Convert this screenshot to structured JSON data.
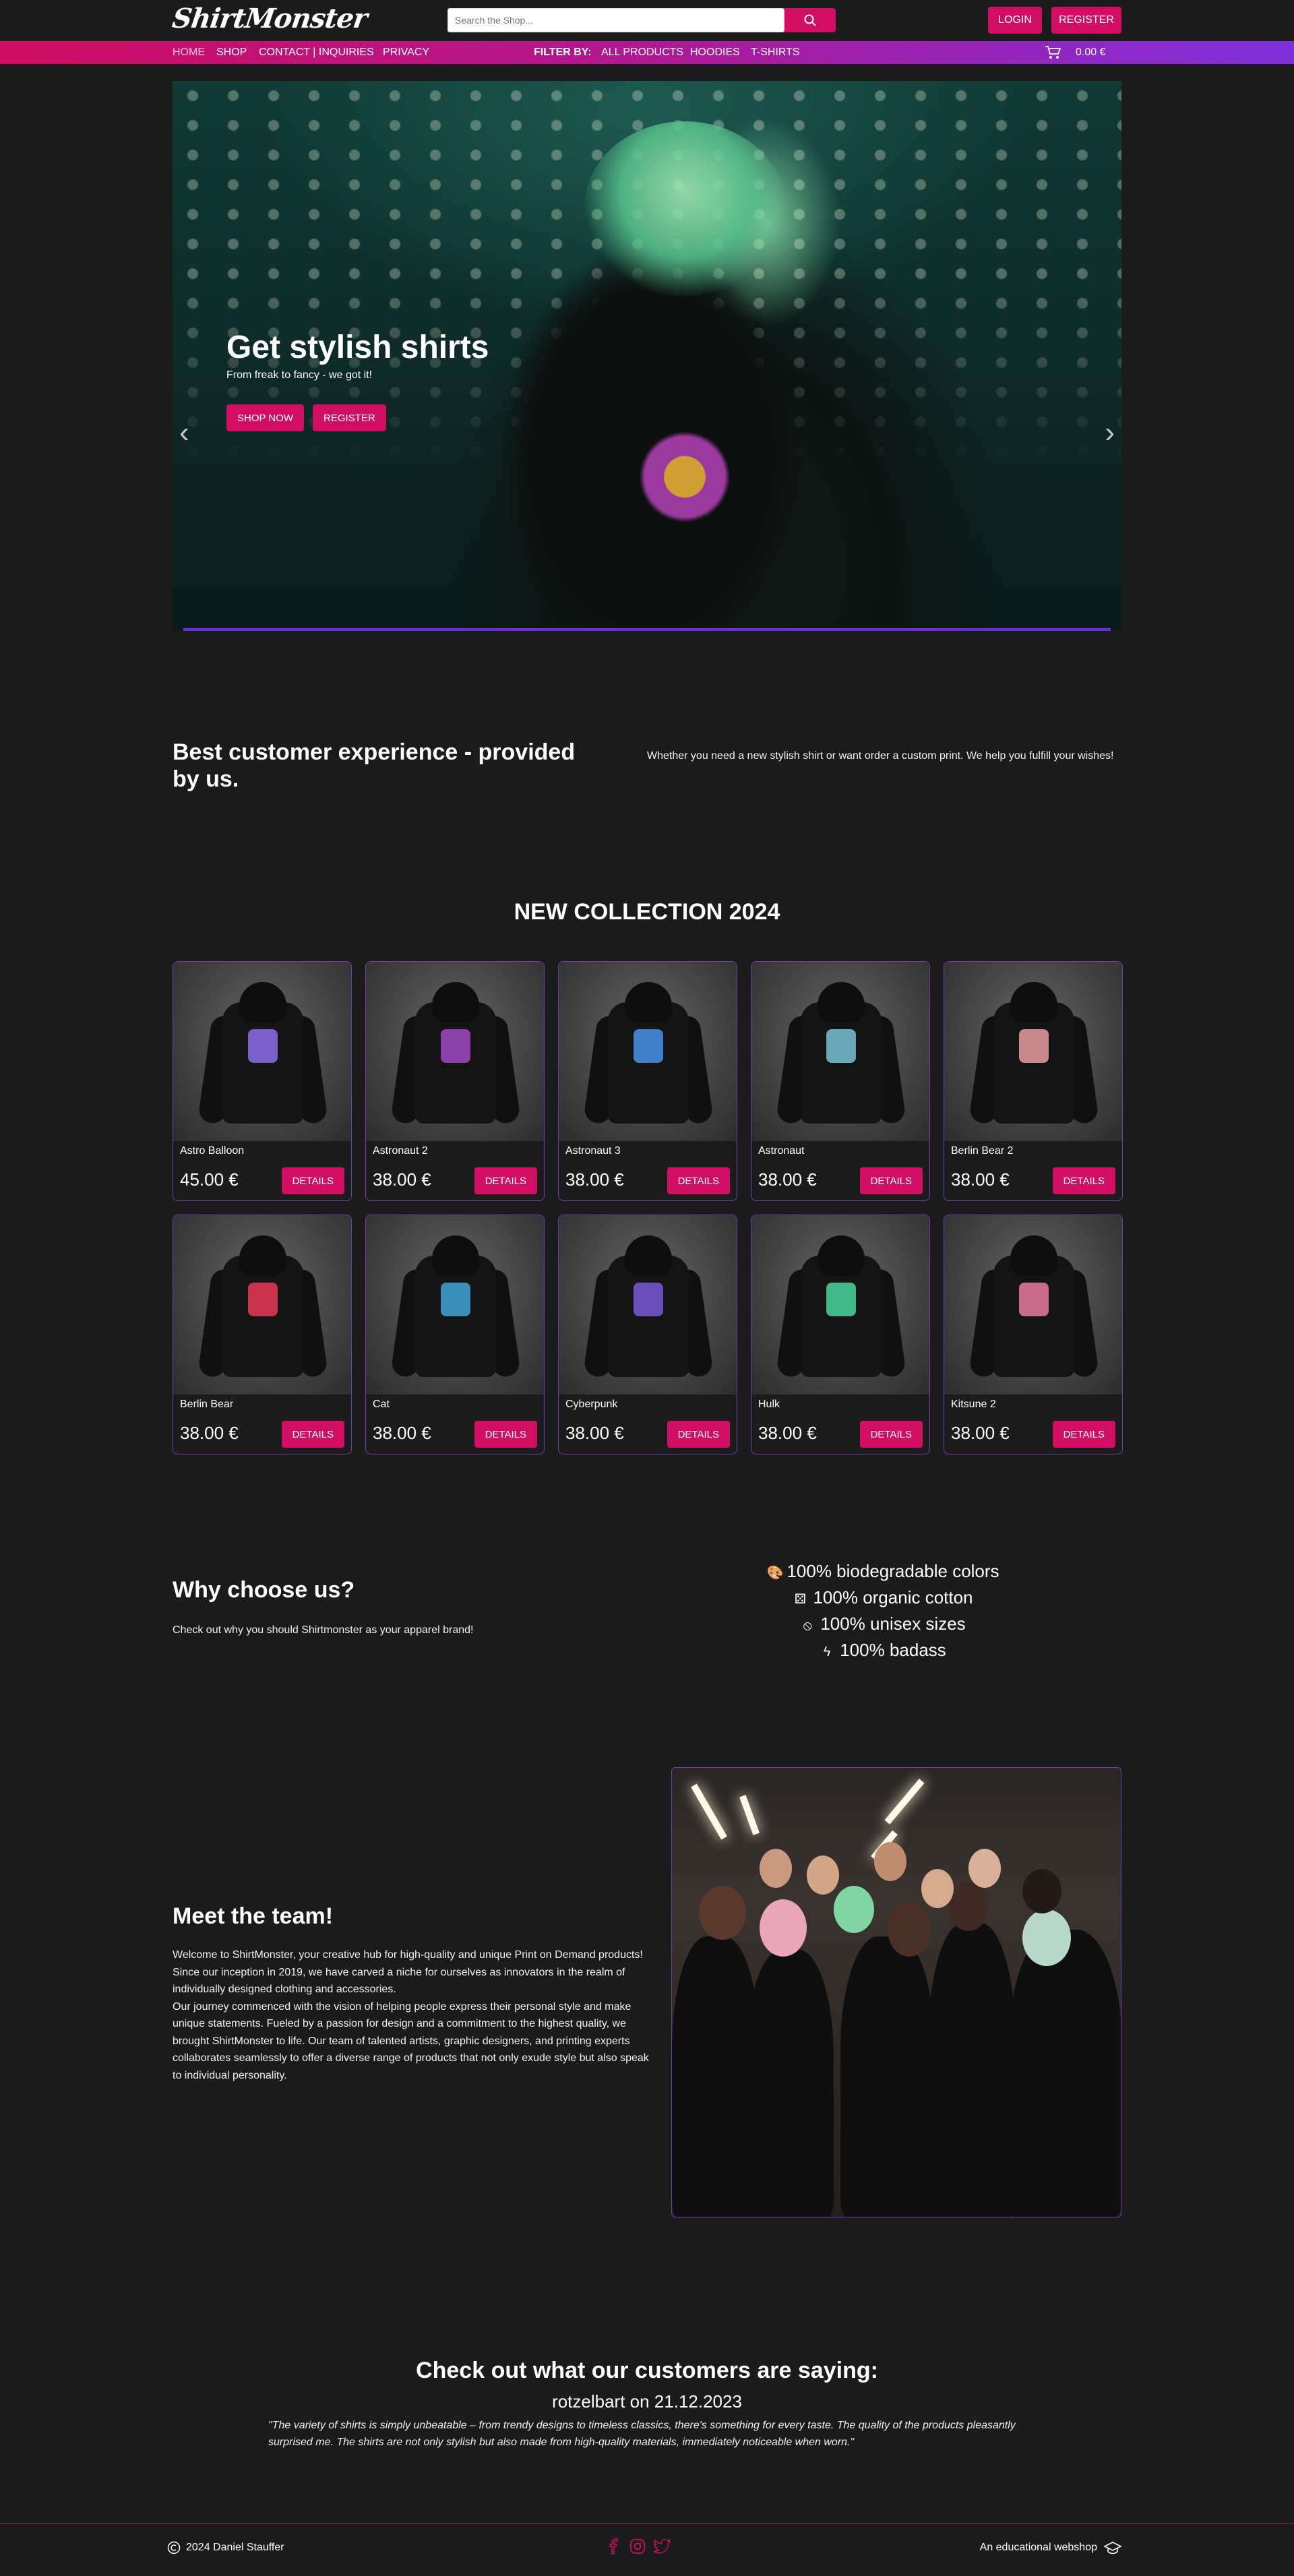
{
  "header": {
    "logo": "ShirtMonster",
    "search_placeholder": "Search the Shop...",
    "login_label": "LOGIN",
    "register_label": "REGISTER"
  },
  "nav": {
    "items": [
      {
        "label": "HOME",
        "active": true
      },
      {
        "label": "SHOP"
      },
      {
        "label": "CONTACT | INQUIRIES"
      },
      {
        "label": "PRIVACY"
      }
    ],
    "filter_label": "FILTER BY:",
    "filters": [
      "ALL PRODUCTS",
      "HOODIES",
      "T-SHIRTS"
    ],
    "cart_total": "0.00 €"
  },
  "hero": {
    "title": "Get stylish shirts",
    "subtitle": "From freak to fancy - we got it!",
    "shop_now_label": "SHOP NOW",
    "register_label": "REGISTER"
  },
  "intro": {
    "title": "Best customer experience - provided by us.",
    "text": "Whether you need a new stylish shirt or want order a custom print. We help you fulfill your wishes!"
  },
  "collection": {
    "title": "NEW COLLECTION 2024",
    "details_label": "DETAILS",
    "products": [
      {
        "name": "Astro Balloon",
        "price": "45.00 €",
        "design_color": "#7a5fc8"
      },
      {
        "name": "Astronaut 2",
        "price": "38.00 €",
        "design_color": "#8b3fa8"
      },
      {
        "name": "Astronaut 3",
        "price": "38.00 €",
        "design_color": "#3f7fc8"
      },
      {
        "name": "Astronaut",
        "price": "38.00 €",
        "design_color": "#6aa7b8"
      },
      {
        "name": "Berlin Bear 2",
        "price": "38.00 €",
        "design_color": "#c88a8a"
      },
      {
        "name": "Berlin Bear",
        "price": "38.00 €",
        "design_color": "#c8324a"
      },
      {
        "name": "Cat",
        "price": "38.00 €",
        "design_color": "#3a8fb8"
      },
      {
        "name": "Cyberpunk",
        "price": "38.00 €",
        "design_color": "#6a4fb8"
      },
      {
        "name": "Hulk",
        "price": "38.00 €",
        "design_color": "#3fb88a"
      },
      {
        "name": "Kitsune 2",
        "price": "38.00 €",
        "design_color": "#c86a8a"
      }
    ]
  },
  "why": {
    "title": "Why choose us?",
    "text": "Check out why you should Shirtmonster as your apparel brand!",
    "features": [
      {
        "icon": "palette-icon",
        "glyph": "🎨",
        "label": "100% biodegradable colors"
      },
      {
        "icon": "dice-icon",
        "glyph": "⚄",
        "label": "100% organic cotton"
      },
      {
        "icon": "slash-circle-icon",
        "glyph": "⦸",
        "label": "100% unisex sizes"
      },
      {
        "icon": "lightning-icon",
        "glyph": "ϟ",
        "label": "100% badass"
      }
    ]
  },
  "team": {
    "title": "Meet the team!",
    "text": "Welcome to ShirtMonster, your creative hub for high-quality and unique Print on Demand products! Since our inception in 2019, we have carved a niche for ourselves as innovators in the realm of individually designed clothing and accessories.\nOur journey commenced with the vision of helping people express their personal style and make unique statements. Fueled by a passion for design and a commitment to the highest quality, we brought ShirtMonster to life. Our team of talented artists, graphic designers, and printing experts collaborates seamlessly to offer a diverse range of products that not only exude style but also speak to individual personality."
  },
  "testimonial": {
    "title": "Check out what our customers are saying:",
    "author_line": "rotzelbart on 21.12.2023",
    "quote": "\"The variety of shirts is simply unbeatable – from trendy designs to timeless classics, there's something for every taste. The quality of the products pleasantly surprised me. The shirts are not only stylish but also made from high-quality materials, immediately noticeable when worn.\""
  },
  "footer": {
    "copyright": "2024 Daniel Stauffer",
    "tagline": "An educational webshop"
  },
  "colors": {
    "accent": "#d10e63",
    "purple": "#7f2fdb",
    "background": "#1b1b1b"
  }
}
